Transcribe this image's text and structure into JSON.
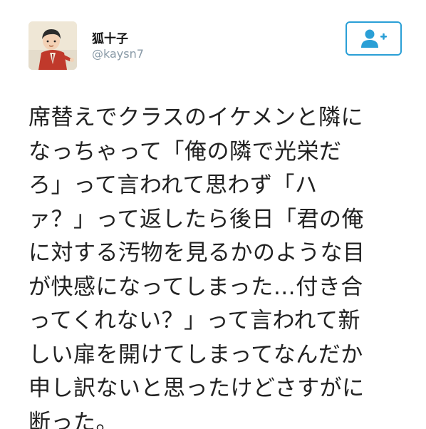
{
  "user": {
    "display_name": "狐十子",
    "handle": "@kaysn7",
    "avatar_icon": "user-avatar-icon"
  },
  "follow_button": {
    "icon": "add-user-icon",
    "accent_color": "#2a9fd6"
  },
  "tweet": {
    "lines": [
      "席替えでクラスのイケメンと隣に",
      "なっちゃって「俺の隣で光栄だ",
      "ろ」って言われて思わず「ハ",
      "ァ？」って返したら後日「君の俺",
      "に対する汚物を見るかのような目",
      "が快感になってしまった…付き合",
      "ってくれない？」って言われて新",
      "しい扉を開けてしまってなんだか",
      "申し訳ないと思ったけどさすがに",
      "断った。"
    ]
  }
}
